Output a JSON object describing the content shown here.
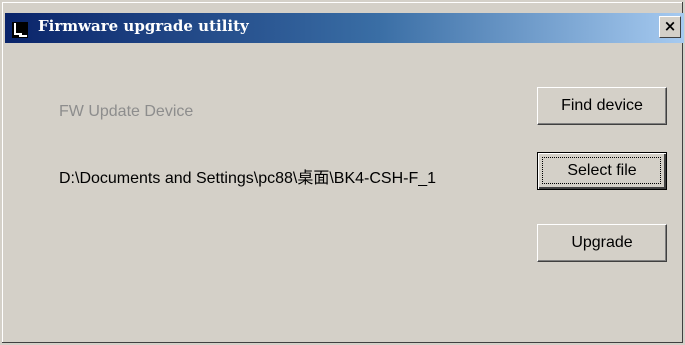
{
  "window": {
    "title": "Firmware upgrade utility",
    "close_glyph": "×"
  },
  "icons": {
    "app": "app-window-icon",
    "close": "close-icon"
  },
  "main": {
    "device_label": "FW Update Device",
    "file_path": "D:\\Documents and Settings\\pc88\\桌面\\BK4-CSH-F_1"
  },
  "buttons": {
    "find_device": "Find device",
    "select_file": "Select file",
    "upgrade": "Upgrade"
  },
  "colors": {
    "dialog_background": "#d4d0c8",
    "titlebar_start": "#0a246a",
    "titlebar_end": "#a6caf0",
    "disabled_text": "#8d8d8d"
  }
}
